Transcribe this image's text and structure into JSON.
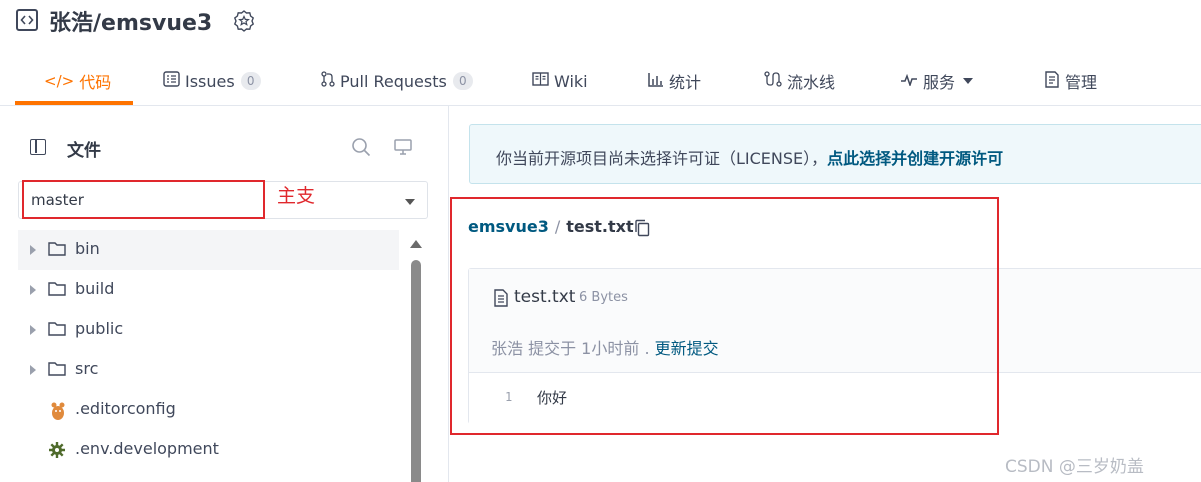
{
  "repo": {
    "title": "张浩/emsvue3"
  },
  "tabs": [
    {
      "label": "代码",
      "icon": "code-icon"
    },
    {
      "label": "Issues",
      "icon": "issues-icon",
      "count": "0"
    },
    {
      "label": "Pull Requests",
      "icon": "pull-request-icon",
      "count": "0"
    },
    {
      "label": "Wiki",
      "icon": "wiki-icon"
    },
    {
      "label": "统计",
      "icon": "chart-icon"
    },
    {
      "label": "流水线",
      "icon": "pipeline-icon"
    },
    {
      "label": "服务",
      "icon": "pulse-icon"
    },
    {
      "label": "管理",
      "icon": "manage-icon"
    }
  ],
  "sidebar": {
    "title": "文件",
    "branch": "master",
    "branch_annotation": "主支",
    "tree": [
      {
        "name": "bin",
        "type": "folder"
      },
      {
        "name": "build",
        "type": "folder"
      },
      {
        "name": "public",
        "type": "folder"
      },
      {
        "name": "src",
        "type": "folder"
      },
      {
        "name": ".editorconfig",
        "type": "file",
        "icon": "mascot-icon"
      },
      {
        "name": ".env.development",
        "type": "file",
        "icon": "gear-icon"
      }
    ]
  },
  "license": {
    "text": "你当前开源项目尚未选择许可证（LICENSE），",
    "link": "点此选择并创建开源许可"
  },
  "breadcrumb": {
    "root": "emsvue3",
    "separator": "/",
    "file": "test.txt"
  },
  "file": {
    "name": "test.txt",
    "size": "6 Bytes",
    "commit_text": "张浩 提交于 1小时前 . ",
    "commit_link": "更新提交",
    "lines": [
      {
        "no": "1",
        "code": "你好"
      }
    ]
  },
  "watermark": "CSDN @三岁奶盖",
  "colors": {
    "accent": "#fe7300",
    "link": "#005980",
    "annotation": "#e0282d"
  }
}
